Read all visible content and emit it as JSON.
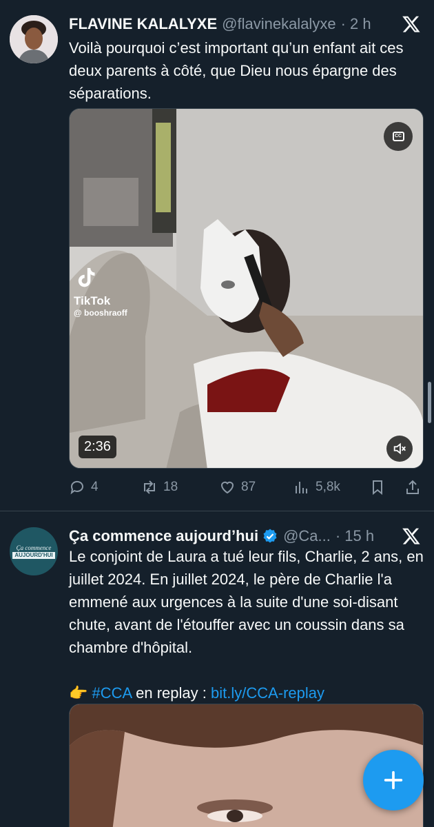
{
  "tweets": [
    {
      "name": "FLAVINE KALALYXE",
      "handle": "@flavinekalalyxe",
      "time": "· 2 h",
      "text": "Voilà pourquoi c’est important qu’un enfant ait ces deux parents à côté, que Dieu nous épargne des séparations.",
      "media": {
        "duration": "2:36",
        "tiktok_label": "TikTok",
        "tiktok_user": "@ booshraoff"
      },
      "actions": {
        "replies": "4",
        "reposts": "18",
        "likes": "87",
        "views": "5,8k"
      }
    },
    {
      "name": "Ça commence aujourd’hui",
      "handle": "@Ca...",
      "time": "· 15 h",
      "verified": true,
      "text": "Le conjoint de Laura a tué leur fils, Charlie, 2 ans, en juillet 2024. En juillet 2024, le père de Charlie l'a emmené aux urgences à la suite d'une soi-disant chute, avant de l'étouffer avec un coussin dans sa chambre d'hôpital.",
      "cta_emoji": "👉",
      "hashtag": "#CCA",
      "cta_text": " en replay : ",
      "link": "bit.ly/CCA-replay",
      "avatar_line1": "Ça commence",
      "avatar_line2": "AUJOURD'HUI"
    }
  ],
  "colors": {
    "background": "#15202b",
    "text": "#f7f9f9",
    "secondary": "#8b98a5",
    "accent": "#1d9bf0",
    "divider": "#38444d"
  },
  "icons": [
    "x-logo-icon",
    "cc-icon",
    "mute-icon",
    "reply-icon",
    "repost-icon",
    "like-icon",
    "views-icon",
    "bookmark-icon",
    "share-icon",
    "verified-icon",
    "compose-plus-icon"
  ]
}
